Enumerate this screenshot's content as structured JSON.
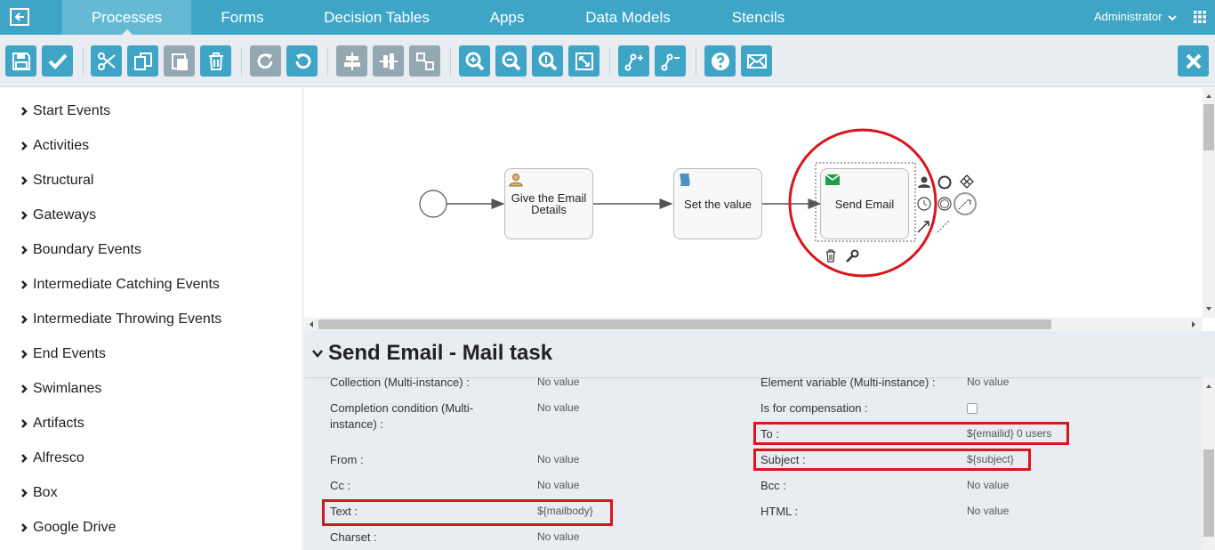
{
  "nav": {
    "tabs": [
      {
        "label": "Processes"
      },
      {
        "label": "Forms"
      },
      {
        "label": "Decision Tables"
      },
      {
        "label": "Apps"
      },
      {
        "label": "Data Models"
      },
      {
        "label": "Stencils"
      }
    ],
    "active_tab": "Processes",
    "user": "Administrator"
  },
  "palette": {
    "items": [
      {
        "label": "Start Events"
      },
      {
        "label": "Activities"
      },
      {
        "label": "Structural"
      },
      {
        "label": "Gateways"
      },
      {
        "label": "Boundary Events"
      },
      {
        "label": "Intermediate Catching Events"
      },
      {
        "label": "Intermediate Throwing Events"
      },
      {
        "label": "End Events"
      },
      {
        "label": "Swimlanes"
      },
      {
        "label": "Artifacts"
      },
      {
        "label": "Alfresco"
      },
      {
        "label": "Box"
      },
      {
        "label": "Google Drive"
      }
    ]
  },
  "diagram": {
    "task1": "Give the Email Details",
    "task2": "Set the value",
    "task3": "Send Email"
  },
  "properties": {
    "title": "Send Email - Mail task",
    "left": [
      {
        "label": "Collection (Multi-instance) :",
        "value": "No value"
      },
      {
        "label": "Completion condition (Multi-instance) :",
        "value": "No value"
      },
      {
        "label": "From :",
        "value": "No value"
      },
      {
        "label": "Cc :",
        "value": "No value"
      },
      {
        "label": "Text :",
        "value": "${mailbody}"
      },
      {
        "label": "Charset :",
        "value": "No value"
      }
    ],
    "right": [
      {
        "label": "Element variable (Multi-instance) :",
        "value": "No value"
      },
      {
        "label": "Is for compensation :",
        "value": ""
      },
      {
        "label": "To :",
        "value": "${emailid} 0 users"
      },
      {
        "label": "Subject :",
        "value": "${subject}"
      },
      {
        "label": "Bcc :",
        "value": "No value"
      },
      {
        "label": "HTML :",
        "value": "No value"
      }
    ]
  },
  "colors": {
    "accent": "#3ea5c6",
    "toolbar_bg": "#e9edf1",
    "highlight": "#d8161c"
  }
}
